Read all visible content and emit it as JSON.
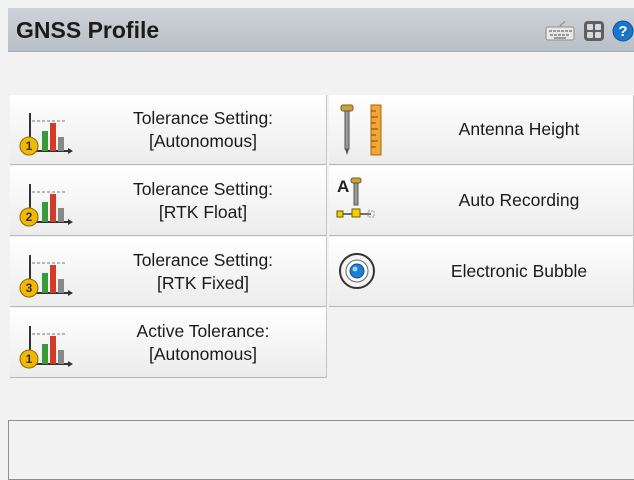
{
  "window": {
    "title": "GNSS Profile"
  },
  "toolbar": {
    "icons": [
      "keyboard-icon",
      "switch-apps-icon",
      "help-icon"
    ],
    "colors": {
      "help": "#1976c8"
    }
  },
  "left_tiles": [
    {
      "line1": "Tolerance Setting:",
      "line2": "[Autonomous]",
      "badge": "1",
      "badge_color": "#f0b800"
    },
    {
      "line1": "Tolerance Setting:",
      "line2": "[RTK Float]",
      "badge": "2",
      "badge_color": "#f0b800"
    },
    {
      "line1": "Tolerance Setting:",
      "line2": "[RTK Fixed]",
      "badge": "3",
      "badge_color": "#f0b800"
    },
    {
      "line1": "Active Tolerance:",
      "line2": "[Autonomous]",
      "badge": "1",
      "badge_color": "#f0b800"
    }
  ],
  "right_tiles": [
    {
      "label": "Antenna Height",
      "icon": "antenna-height-icon"
    },
    {
      "label": "Auto Recording",
      "icon": "auto-recording-icon"
    },
    {
      "label": "Electronic Bubble",
      "icon": "electronic-bubble-icon"
    }
  ],
  "auto_recording_icon_text": "A"
}
